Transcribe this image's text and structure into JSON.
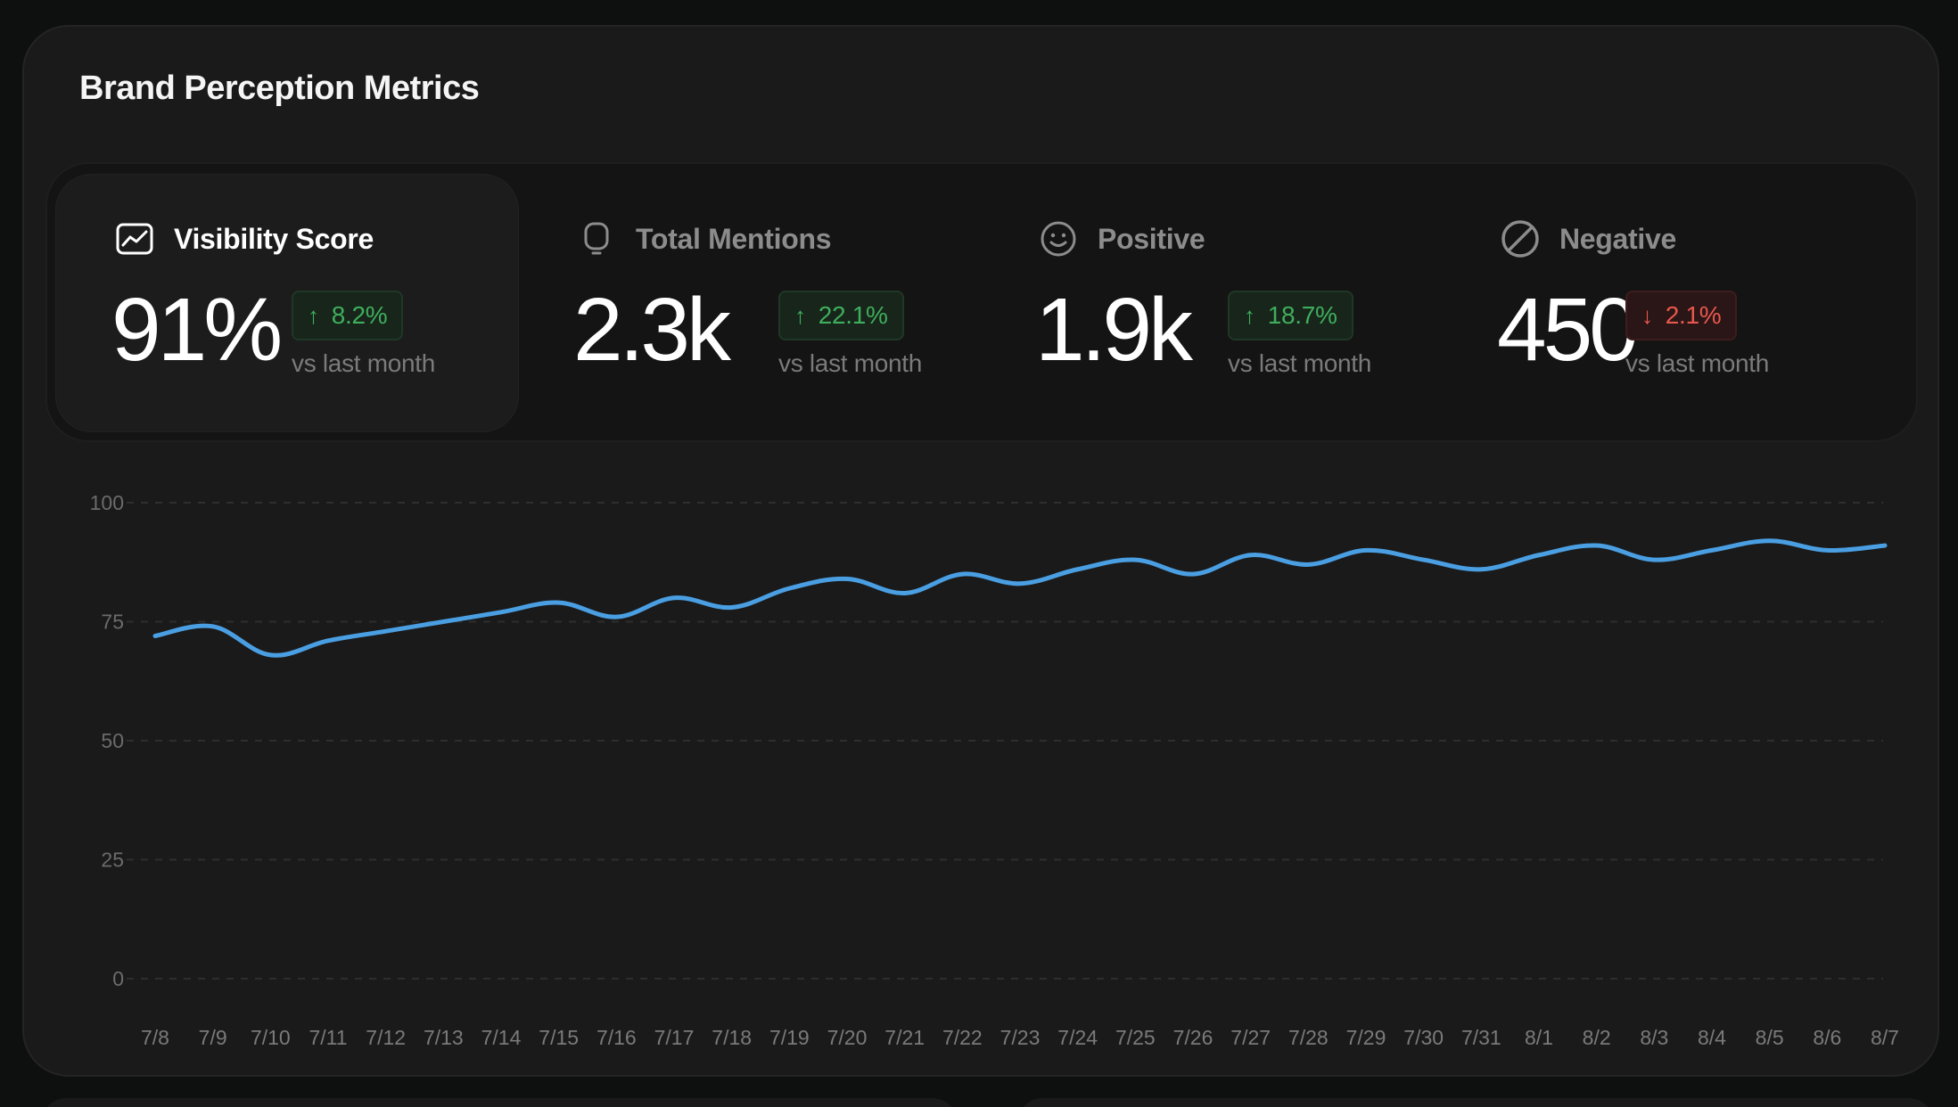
{
  "card": {
    "title": "Brand Perception Metrics"
  },
  "metrics": [
    {
      "label": "Visibility Score",
      "icon": "trend-chart-icon",
      "value": "91%",
      "change": "8.2%",
      "direction": "up",
      "sub": "vs last month",
      "active": true
    },
    {
      "label": "Total Mentions",
      "icon": "chat-bubble-icon",
      "value": "2.3k",
      "change": "22.1%",
      "direction": "up",
      "sub": "vs last month",
      "active": false
    },
    {
      "label": "Positive",
      "icon": "smile-icon",
      "value": "1.9k",
      "change": "18.7%",
      "direction": "up",
      "sub": "vs last month",
      "active": false
    },
    {
      "label": "Negative",
      "icon": "prohibit-icon",
      "value": "450",
      "change": "2.1%",
      "direction": "down",
      "sub": "vs last month",
      "active": false
    }
  ],
  "colors": {
    "line": "#4a9fe3",
    "up": "#3fae5c",
    "down": "#e8574d"
  },
  "chart_data": {
    "type": "line",
    "title": "",
    "xlabel": "",
    "ylabel": "",
    "ylim": [
      0,
      100
    ],
    "yticks": [
      0,
      25,
      50,
      75,
      100
    ],
    "grid": true,
    "categories": [
      "7/8",
      "7/9",
      "7/10",
      "7/11",
      "7/12",
      "7/13",
      "7/14",
      "7/15",
      "7/16",
      "7/17",
      "7/18",
      "7/19",
      "7/20",
      "7/21",
      "7/22",
      "7/23",
      "7/24",
      "7/25",
      "7/26",
      "7/27",
      "7/28",
      "7/29",
      "7/30",
      "7/31",
      "8/1",
      "8/2",
      "8/3",
      "8/4",
      "8/5",
      "8/6",
      "8/7"
    ],
    "series": [
      {
        "values": [
          72,
          74,
          68,
          71,
          73,
          75,
          77,
          79,
          76,
          80,
          78,
          82,
          84,
          81,
          85,
          83,
          86,
          88,
          85,
          89,
          87,
          90,
          88,
          86,
          89,
          91,
          88,
          90,
          92,
          90,
          91
        ]
      }
    ]
  }
}
